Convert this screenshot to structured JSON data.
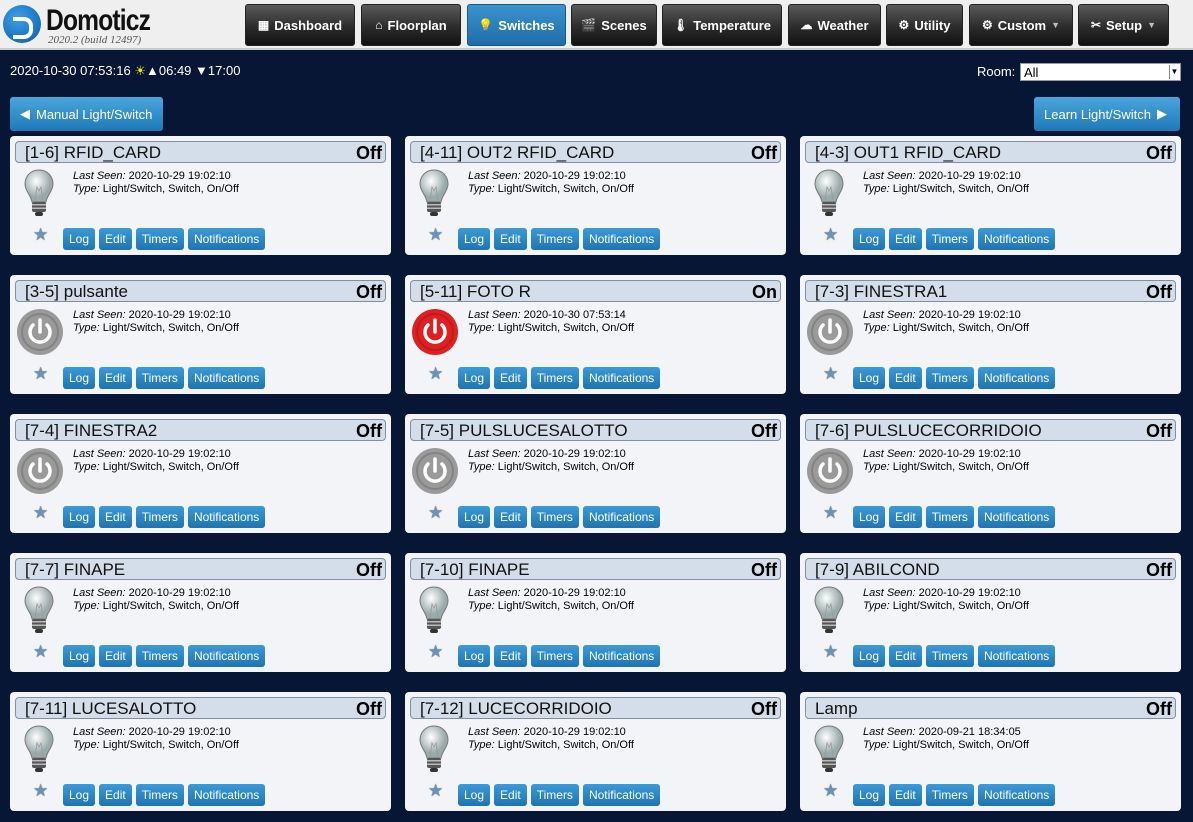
{
  "app": {
    "name": "Domoticz",
    "version": "2020.2 (build 12497)"
  },
  "nav": [
    {
      "label": "Dashboard",
      "icon": "dashboard-icon",
      "glyph": "▦",
      "active": false
    },
    {
      "label": "Floorplan",
      "icon": "house-icon",
      "glyph": "⌂",
      "active": false
    },
    {
      "label": "Switches",
      "icon": "lightbulb-icon",
      "glyph": "💡",
      "active": true
    },
    {
      "label": "Scenes",
      "icon": "clapperboard-icon",
      "glyph": "🎬",
      "active": false
    },
    {
      "label": "Temperature",
      "icon": "thermometer-icon",
      "glyph": "🌡",
      "active": false
    },
    {
      "label": "Weather",
      "icon": "cloud-icon",
      "glyph": "☁",
      "active": false
    },
    {
      "label": "Utility",
      "icon": "utility-icon",
      "glyph": "⚙",
      "active": false
    },
    {
      "label": "Custom",
      "icon": "gear-icon",
      "glyph": "⚙",
      "active": false,
      "dropdown": true
    },
    {
      "label": "Setup",
      "icon": "tools-icon",
      "glyph": "✂",
      "active": false,
      "dropdown": true
    }
  ],
  "status": {
    "datetime": "2020-10-30 07:53:16",
    "sun_icon": "☀",
    "sunrise": "▲06:49",
    "sunset": "▼17:00"
  },
  "room": {
    "label": "Room:",
    "value": "All"
  },
  "actions": {
    "manual": "Manual Light/Switch",
    "learn": "Learn Light/Switch"
  },
  "labels": {
    "last_seen": "Last Seen:",
    "type": "Type:",
    "log": "Log",
    "edit": "Edit",
    "timers": "Timers",
    "notifications": "Notifications"
  },
  "colors": {
    "on": "#e02020",
    "off": "#9a9a9a",
    "accent": "#1f79b8"
  },
  "devices": [
    {
      "name": "[1-6] RFID_CARD",
      "status": "Off",
      "icon": "bulb",
      "last_seen": "2020-10-29 19:02:10",
      "type": "Light/Switch, Switch, On/Off"
    },
    {
      "name": "[4-11] OUT2 RFID_CARD",
      "status": "Off",
      "icon": "bulb",
      "last_seen": "2020-10-29 19:02:10",
      "type": "Light/Switch, Switch, On/Off"
    },
    {
      "name": "[4-3] OUT1 RFID_CARD",
      "status": "Off",
      "icon": "bulb",
      "last_seen": "2020-10-29 19:02:10",
      "type": "Light/Switch, Switch, On/Off"
    },
    {
      "name": "[3-5] pulsante",
      "status": "Off",
      "icon": "power",
      "last_seen": "2020-10-29 19:02:10",
      "type": "Light/Switch, Switch, On/Off"
    },
    {
      "name": "[5-11] FOTO R",
      "status": "On",
      "icon": "power",
      "last_seen": "2020-10-30 07:53:14",
      "type": "Light/Switch, Switch, On/Off"
    },
    {
      "name": "[7-3] FINESTRA1",
      "status": "Off",
      "icon": "power",
      "last_seen": "2020-10-29 19:02:10",
      "type": "Light/Switch, Switch, On/Off"
    },
    {
      "name": "[7-4] FINESTRA2",
      "status": "Off",
      "icon": "power",
      "last_seen": "2020-10-29 19:02:10",
      "type": "Light/Switch, Switch, On/Off"
    },
    {
      "name": "[7-5] PULSLUCESALOTTO",
      "status": "Off",
      "icon": "power",
      "last_seen": "2020-10-29 19:02:10",
      "type": "Light/Switch, Switch, On/Off"
    },
    {
      "name": "[7-6] PULSLUCECORRIDOIO",
      "status": "Off",
      "icon": "power",
      "last_seen": "2020-10-29 19:02:10",
      "type": "Light/Switch, Switch, On/Off"
    },
    {
      "name": "[7-7] FINAPE",
      "status": "Off",
      "icon": "bulb",
      "last_seen": "2020-10-29 19:02:10",
      "type": "Light/Switch, Switch, On/Off"
    },
    {
      "name": "[7-10] FINAPE",
      "status": "Off",
      "icon": "bulb",
      "last_seen": "2020-10-29 19:02:10",
      "type": "Light/Switch, Switch, On/Off"
    },
    {
      "name": "[7-9] ABILCOND",
      "status": "Off",
      "icon": "bulb",
      "last_seen": "2020-10-29 19:02:10",
      "type": "Light/Switch, Switch, On/Off"
    },
    {
      "name": "[7-11] LUCESALOTTO",
      "status": "Off",
      "icon": "bulb",
      "last_seen": "2020-10-29 19:02:10",
      "type": "Light/Switch, Switch, On/Off"
    },
    {
      "name": "[7-12] LUCECORRIDOIO",
      "status": "Off",
      "icon": "bulb",
      "last_seen": "2020-10-29 19:02:10",
      "type": "Light/Switch, Switch, On/Off"
    },
    {
      "name": "Lamp",
      "status": "Off",
      "icon": "bulb",
      "last_seen": "2020-09-21 18:34:05",
      "type": "Light/Switch, Switch, On/Off"
    }
  ]
}
